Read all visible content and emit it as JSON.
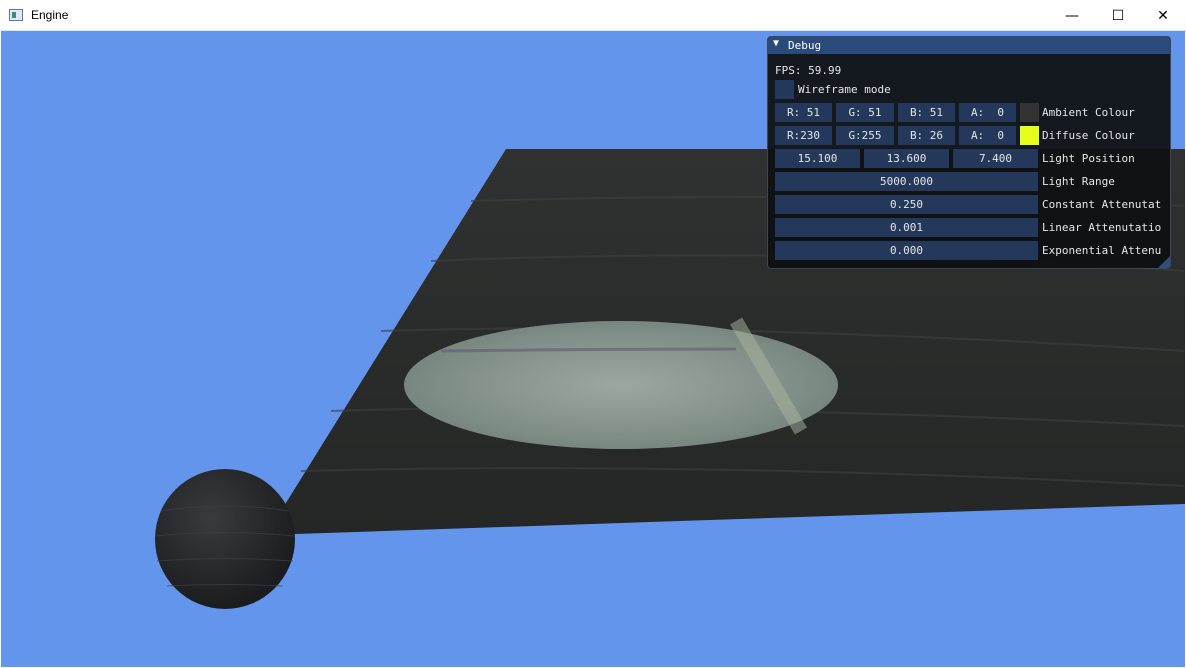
{
  "window": {
    "title": "Engine",
    "minimize_glyph": "—",
    "maximize_glyph": "☐",
    "close_glyph": "✕"
  },
  "scene": {
    "background_color": "#6495ed",
    "floor_color": "#2c2f2d",
    "spotlight_color": "#8d9b92",
    "sphere_color": "#2a2b2d"
  },
  "debug": {
    "title": "Debug",
    "collapse_glyph": "▼",
    "fps_label": "FPS:",
    "fps_value": "59.99",
    "wireframe_label": "Wireframe mode",
    "wireframe_checked": false,
    "ambient": {
      "r": "R: 51",
      "g": "G: 51",
      "b": "B: 51",
      "a": "A:  0",
      "swatch": "#333333",
      "label": "Ambient Colour"
    },
    "diffuse": {
      "r": "R:230",
      "g": "G:255",
      "b": "B: 26",
      "a": "A:  0",
      "swatch": "#e6ff1a",
      "label": "Diffuse Colour"
    },
    "light_position": {
      "x": "15.100",
      "y": "13.600",
      "z": "7.400",
      "label": "Light Position"
    },
    "light_range": {
      "value": "5000.000",
      "label": "Light Range"
    },
    "constant_attenuation": {
      "value": "0.250",
      "label": "Constant Attenutat"
    },
    "linear_attenuation": {
      "value": "0.001",
      "label": "Linear Attenutatio"
    },
    "exponential_attenuation": {
      "value": "0.000",
      "label": "Exponential Attenu"
    }
  }
}
